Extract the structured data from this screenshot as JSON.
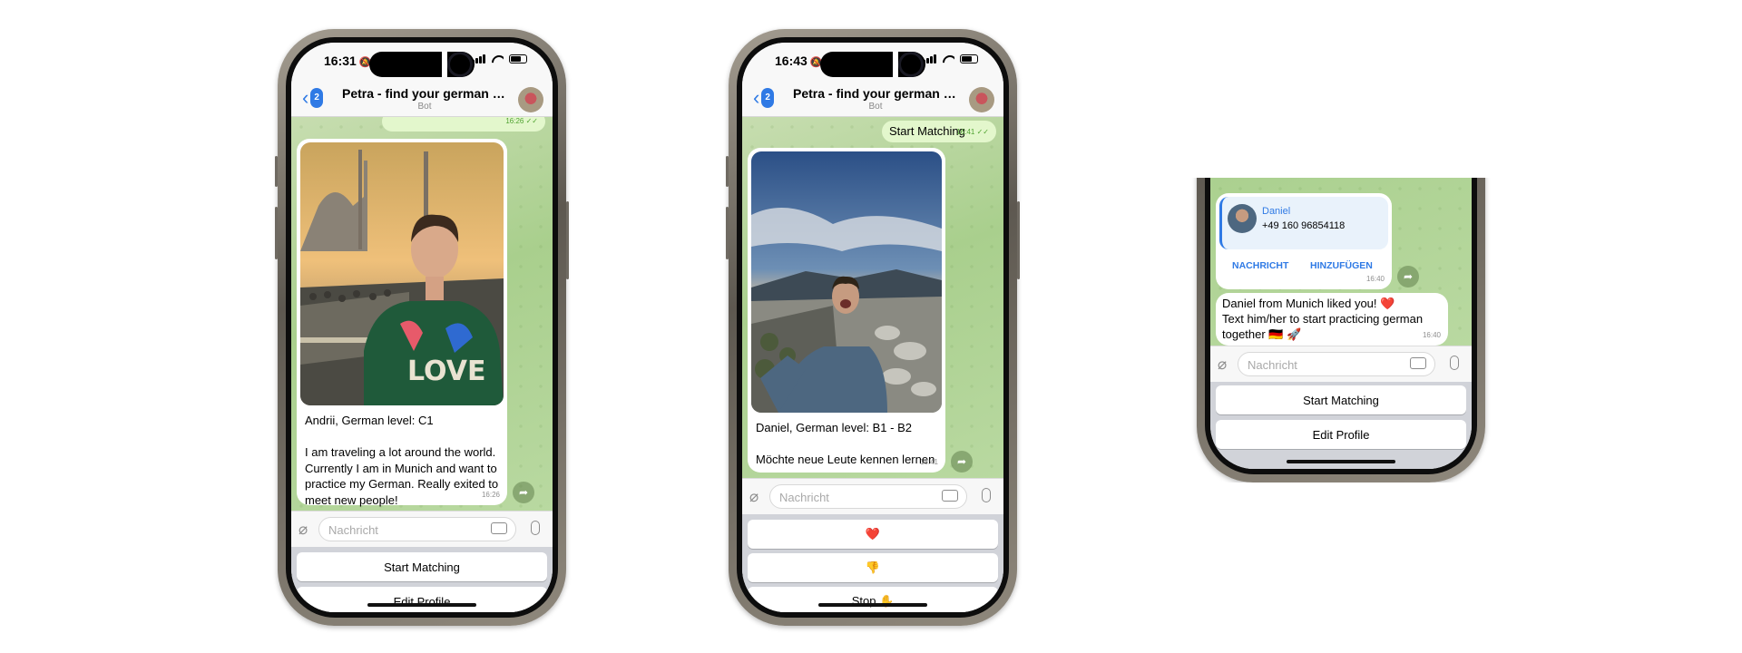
{
  "phones": [
    {
      "status": {
        "time": "16:31"
      },
      "header": {
        "back_count": "2",
        "title": "Petra - find your german bud...",
        "subtitle": "Bot"
      },
      "prev_msg_time": "16:26",
      "profile": {
        "name_line": "Andrii, German level: C1",
        "bio": "I am traveling a lot around the world. Currently I am in Munich and want to practice my German. Really exited to meet new people!",
        "time": "16:26"
      },
      "input_placeholder": "Nachricht",
      "keyboard": [
        "Start Matching",
        "Edit Profile"
      ]
    },
    {
      "status": {
        "time": "16:43"
      },
      "header": {
        "back_count": "2",
        "title": "Petra - find your german bud...",
        "subtitle": "Bot"
      },
      "out_msg": {
        "text": "Start Matching",
        "time": "16:41"
      },
      "profile": {
        "name_line": "Daniel, German level: B1 - B2",
        "bio": "Möchte neue Leute kennen lernen",
        "time": "16:41"
      },
      "input_placeholder": "Nachricht",
      "keyboard": [
        "❤️",
        "👎",
        "Stop ✋"
      ]
    },
    {
      "contact": {
        "name": "Daniel",
        "phone": "+49 160 96854118",
        "action_message": "NACHRICHT",
        "action_add": "HINZUFÜGEN",
        "time": "16:40"
      },
      "like_msg": {
        "text": "Daniel from Munich liked you! ❤️\nText him/her to start practicing german together 🇩🇪 🚀",
        "time": "16:40"
      },
      "input_placeholder": "Nachricht",
      "keyboard": [
        "Start Matching",
        "Edit Profile"
      ]
    }
  ],
  "colors": {
    "accent": "#2f7ae5",
    "chat_bg": "#b5d59c",
    "outgoing": "#e3f7cc"
  }
}
